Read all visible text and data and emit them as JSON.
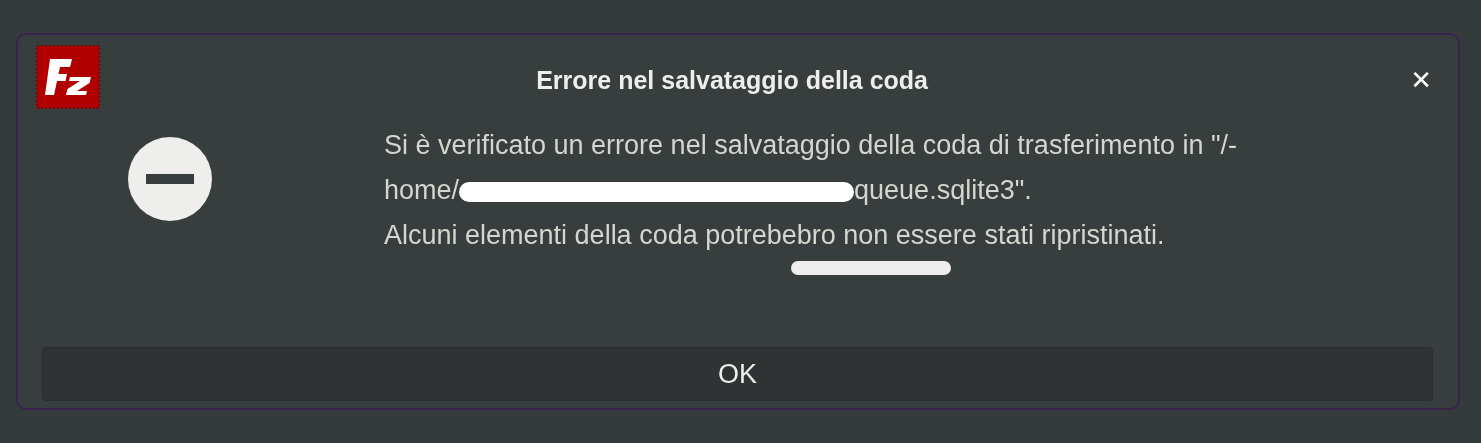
{
  "dialog": {
    "title": "Errore nel salvataggio della coda",
    "close": "✕",
    "message_lines": [
      {
        "parts": [
          "Si è verificato un errore nel salvataggio della coda di trasferimento in \"/-"
        ]
      },
      {
        "parts": [
          "home/",
          "queue.sqlite3\"."
        ]
      },
      {
        "parts": [
          "Alcuni elementi della coda potrebebro non essere stati ripristinati."
        ]
      }
    ],
    "buttons": [
      "OK"
    ]
  }
}
